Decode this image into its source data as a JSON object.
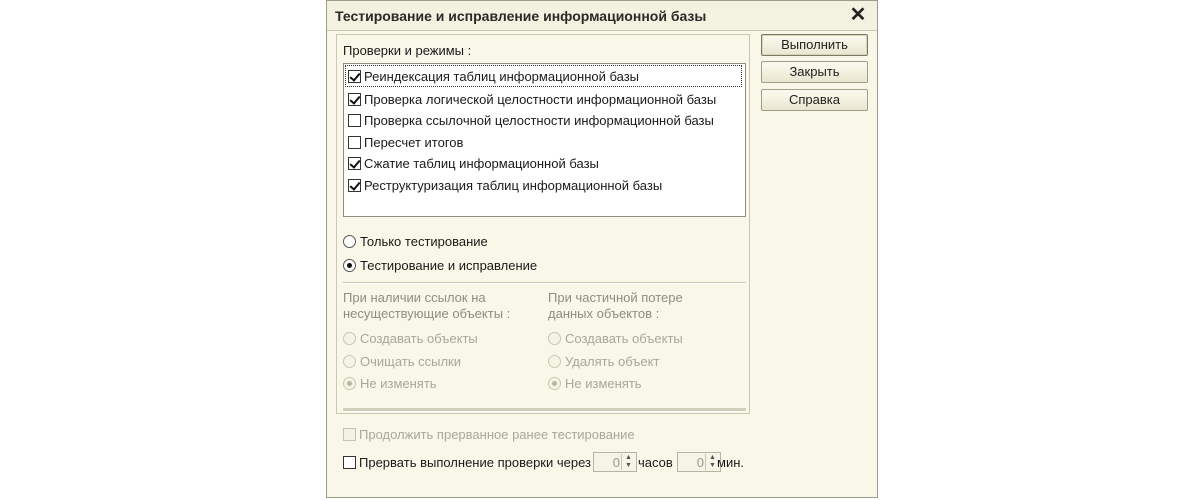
{
  "dialog": {
    "title": "Тестирование и исправление информационной базы",
    "close_icon": "close-icon"
  },
  "buttons": {
    "run": "Выполнить",
    "close": "Закрыть",
    "help": "Справка"
  },
  "checks": {
    "group_label": "Проверки и режимы :",
    "items": [
      {
        "label": "Реиндексация таблиц информационной базы",
        "checked": true
      },
      {
        "label": "Проверка логической целостности информационной базы",
        "checked": true
      },
      {
        "label": "Проверка ссылочной целостности информационной базы",
        "checked": false
      },
      {
        "label": "Пересчет итогов",
        "checked": false
      },
      {
        "label": "Сжатие таблиц информационной базы",
        "checked": true
      },
      {
        "label": "Реструктуризация таблиц информационной базы",
        "checked": true
      }
    ]
  },
  "mode": {
    "test_only": "Только тестирование",
    "test_and_fix": "Тестирование и исправление",
    "selected": "test_and_fix"
  },
  "missing_refs": {
    "label_line1": "При наличии ссылок на",
    "label_line2": "несуществующие объекты :",
    "options": [
      "Создавать объекты",
      "Очищать ссылки",
      "Не изменять"
    ],
    "selected": 2
  },
  "partial_loss": {
    "label_line1": "При частичной потере",
    "label_line2": "данных объектов :",
    "options": [
      "Создавать объекты",
      "Удалять объект",
      "Не изменять"
    ],
    "selected": 2
  },
  "continue": {
    "label": "Продолжить прерванное ранее тестирование",
    "checked": false
  },
  "interrupt": {
    "label": "Прервать выполнение проверки через",
    "checked": false,
    "hours_value": "0",
    "hours_label": "часов",
    "minutes_value": "0",
    "minutes_label": "мин."
  }
}
